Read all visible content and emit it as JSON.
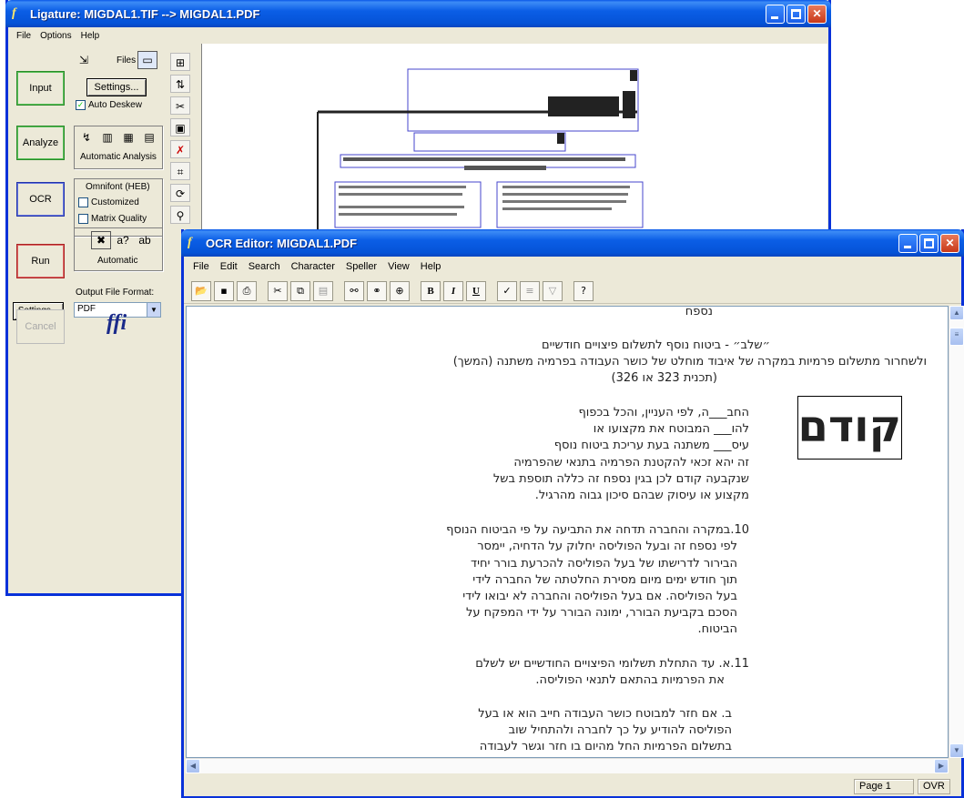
{
  "ligature": {
    "title": "Ligature:  MIGDAL1.TIF  -->  MIGDAL1.PDF",
    "menu": [
      "File",
      "Options",
      "Help"
    ],
    "input_button": "Input",
    "files_label": "Files",
    "settings_button": "Settings...",
    "auto_deskew": "Auto Deskew",
    "analyze_button": "Analyze",
    "automatic_analysis": "Automatic Analysis",
    "ocr_button": "OCR",
    "omnifont": "Omnifont (HEB)",
    "customized": "Customized",
    "matrix_quality": "Matrix Quality",
    "automatic": "Automatic",
    "run_button": "Run",
    "output_format_label": "Output File Format:",
    "output_settings_button": "Settings...",
    "output_format_value": "PDF",
    "cancel_button": "Cancel",
    "logo": "ffi"
  },
  "ocr_editor": {
    "title": "OCR Editor:  MIGDAL1.PDF",
    "menu": [
      "File",
      "Edit",
      "Search",
      "Character",
      "Speller",
      "View",
      "Help"
    ],
    "toolbar": {
      "bold": "B",
      "italic": "I",
      "underline": "U",
      "help": "?"
    },
    "text_lines": [
      "נספח",
      "״שלב״ - ביטוח נוסף לתשלום פיצויים חודשיים",
      "ולשחרור מתשלום פרמיות במקרה של איבוד מוחלט של כושר העבודה בפרמיה משתנה (המשך)",
      "(תכנית 323 או 326)",
      "החב___ה, לפי העניין, והכל בכפוף",
      "להו___ המבוטח את מקצועו או",
      "עיס___ משתנה בעת עריכת ביטוח נוסף",
      "זה יהא זכאי להקטנת הפרמיה בתנאי שהפרמיה",
      "שנקבעה קודם לכן בגין נספח זה כללה תוספת בשל",
      "מקצוע או עיסוק שבהם סיכון גבוה מהרגיל.",
      "10.במקרה והחברה תדחה את התביעה על פי הביטוח הנוסף",
      "לפי נספח זה ובעל הפוליסה יחלוק על הדחיה, יימסר",
      "הבירור לדרישתו של בעל הפוליסה להכרעת בורר יחיד",
      "תוך חודש ימים מיום מסירת החלטתה של החברה לידי",
      "בעל הפוליסה. אם בעל הפוליסה והחברה לא יבואו לידי",
      "הסכם בקביעת הבורר, ימונה הבורר על ידי המפקח על",
      "הביטוח.",
      "11.א. עד התחלת תשלומי הפיצויים החודשיים יש לשלם",
      "את הפרמיות בהתאם לתנאי הפוליסה.",
      "ב. אם חזר למבוטח כושר העבודה חייב הוא או בעל",
      "הפוליסה להודיע על כך לחברה ולהתחיל שוב",
      "בתשלום הפרמיות החל מהיום בו חזר וגשר לעבודה"
    ],
    "zoom_word": "קודם",
    "status_page": "Page 1",
    "status_mode": "OVR"
  },
  "colors": {
    "titlebar": "#0553d7",
    "window_face": "#ece9d8"
  }
}
